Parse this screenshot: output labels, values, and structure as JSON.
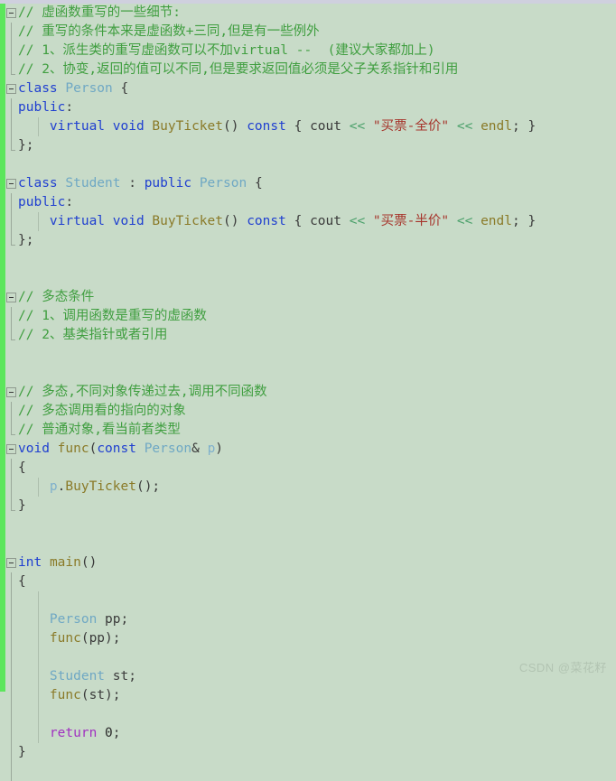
{
  "editor": {
    "background_color": "#c8dbc8",
    "change_bar_color": "#5ce65c",
    "watermark": "CSDN @菜花籽"
  },
  "colors": {
    "comment": "#3f9e3f",
    "keyword": "#1f3fd0",
    "type": "#6fa8c4",
    "function": "#8a7a28",
    "string": "#a6342b",
    "operator": "#4aa06a",
    "return_keyword": "#a030c0",
    "plain": "#3a3a3a"
  },
  "lines": [
    {
      "id": 1,
      "fold": "box",
      "indent": 0,
      "tokens": [
        {
          "t": "// 虚函数重写的一些细节:",
          "c": "cmt"
        }
      ]
    },
    {
      "id": 2,
      "fold": "line",
      "indent": 0,
      "tokens": [
        {
          "t": "// 重写的条件本来是虚函数+三同,但是有一些例外",
          "c": "cmt"
        }
      ]
    },
    {
      "id": 3,
      "fold": "line",
      "indent": 0,
      "tokens": [
        {
          "t": "// 1、派生类的重写虚函数可以不加virtual --  (建议大家都加上)",
          "c": "cmt"
        }
      ]
    },
    {
      "id": 4,
      "fold": "end",
      "indent": 0,
      "tokens": [
        {
          "t": "// 2、协变,返回的值可以不同,但是要求返回值必须是父子关系指针和引用",
          "c": "cmt"
        }
      ]
    },
    {
      "id": 5,
      "fold": "box",
      "indent": 0,
      "tokens": [
        {
          "t": "class",
          "c": "kw"
        },
        {
          "t": " ",
          "c": "plain"
        },
        {
          "t": "Person",
          "c": "type"
        },
        {
          "t": " {",
          "c": "plain"
        }
      ]
    },
    {
      "id": 6,
      "fold": "line",
      "indent": 0,
      "tokens": [
        {
          "t": "public",
          "c": "kw"
        },
        {
          "t": ":",
          "c": "plain"
        }
      ]
    },
    {
      "id": 7,
      "fold": "line",
      "indent": 1,
      "guide": true,
      "tokens": [
        {
          "t": "    ",
          "c": "plain"
        },
        {
          "t": "virtual",
          "c": "kw"
        },
        {
          "t": " ",
          "c": "plain"
        },
        {
          "t": "void",
          "c": "kw"
        },
        {
          "t": " ",
          "c": "plain"
        },
        {
          "t": "BuyTicket",
          "c": "fn"
        },
        {
          "t": "() ",
          "c": "plain"
        },
        {
          "t": "const",
          "c": "kw"
        },
        {
          "t": " { ",
          "c": "plain"
        },
        {
          "t": "cout",
          "c": "plain"
        },
        {
          "t": " ",
          "c": "plain"
        },
        {
          "t": "<<",
          "c": "op"
        },
        {
          "t": " ",
          "c": "plain"
        },
        {
          "t": "\"买票-全价\"",
          "c": "str"
        },
        {
          "t": " ",
          "c": "plain"
        },
        {
          "t": "<<",
          "c": "op"
        },
        {
          "t": " ",
          "c": "plain"
        },
        {
          "t": "endl",
          "c": "fn"
        },
        {
          "t": "; }",
          "c": "plain"
        }
      ]
    },
    {
      "id": 8,
      "fold": "end",
      "indent": 0,
      "tokens": [
        {
          "t": "};",
          "c": "plain"
        }
      ]
    },
    {
      "id": 9,
      "fold": "none",
      "indent": 0,
      "tokens": []
    },
    {
      "id": 10,
      "fold": "box",
      "indent": 0,
      "tokens": [
        {
          "t": "class",
          "c": "kw"
        },
        {
          "t": " ",
          "c": "plain"
        },
        {
          "t": "Student",
          "c": "type"
        },
        {
          "t": " : ",
          "c": "plain"
        },
        {
          "t": "public",
          "c": "kw"
        },
        {
          "t": " ",
          "c": "plain"
        },
        {
          "t": "Person",
          "c": "type"
        },
        {
          "t": " {",
          "c": "plain"
        }
      ]
    },
    {
      "id": 11,
      "fold": "line",
      "indent": 0,
      "tokens": [
        {
          "t": "public",
          "c": "kw"
        },
        {
          "t": ":",
          "c": "plain"
        }
      ]
    },
    {
      "id": 12,
      "fold": "line",
      "indent": 1,
      "guide": true,
      "tokens": [
        {
          "t": "    ",
          "c": "plain"
        },
        {
          "t": "virtual",
          "c": "kw"
        },
        {
          "t": " ",
          "c": "plain"
        },
        {
          "t": "void",
          "c": "kw"
        },
        {
          "t": " ",
          "c": "plain"
        },
        {
          "t": "BuyTicket",
          "c": "fn"
        },
        {
          "t": "() ",
          "c": "plain"
        },
        {
          "t": "const",
          "c": "kw"
        },
        {
          "t": " { ",
          "c": "plain"
        },
        {
          "t": "cout",
          "c": "plain"
        },
        {
          "t": " ",
          "c": "plain"
        },
        {
          "t": "<<",
          "c": "op"
        },
        {
          "t": " ",
          "c": "plain"
        },
        {
          "t": "\"买票-半价\"",
          "c": "str"
        },
        {
          "t": " ",
          "c": "plain"
        },
        {
          "t": "<<",
          "c": "op"
        },
        {
          "t": " ",
          "c": "plain"
        },
        {
          "t": "endl",
          "c": "fn"
        },
        {
          "t": "; }",
          "c": "plain"
        }
      ]
    },
    {
      "id": 13,
      "fold": "end",
      "indent": 0,
      "tokens": [
        {
          "t": "};",
          "c": "plain"
        }
      ]
    },
    {
      "id": 14,
      "fold": "none",
      "indent": 0,
      "tokens": []
    },
    {
      "id": 15,
      "fold": "none",
      "indent": 0,
      "tokens": []
    },
    {
      "id": 16,
      "fold": "box",
      "indent": 0,
      "tokens": [
        {
          "t": "// 多态条件",
          "c": "cmt"
        }
      ]
    },
    {
      "id": 17,
      "fold": "line",
      "indent": 0,
      "tokens": [
        {
          "t": "// 1、调用函数是重写的虚函数",
          "c": "cmt"
        }
      ]
    },
    {
      "id": 18,
      "fold": "end",
      "indent": 0,
      "tokens": [
        {
          "t": "// 2、基类指针或者引用",
          "c": "cmt"
        }
      ]
    },
    {
      "id": 19,
      "fold": "none",
      "indent": 0,
      "tokens": []
    },
    {
      "id": 20,
      "fold": "none",
      "indent": 0,
      "tokens": []
    },
    {
      "id": 21,
      "fold": "box",
      "indent": 0,
      "tokens": [
        {
          "t": "// 多态,不同对象传递过去,调用不同函数",
          "c": "cmt"
        }
      ]
    },
    {
      "id": 22,
      "fold": "line",
      "indent": 0,
      "tokens": [
        {
          "t": "// 多态调用看的指向的对象",
          "c": "cmt"
        }
      ]
    },
    {
      "id": 23,
      "fold": "end",
      "indent": 0,
      "tokens": [
        {
          "t": "// 普通对象,看当前者类型",
          "c": "cmt"
        }
      ]
    },
    {
      "id": 24,
      "fold": "box",
      "indent": 0,
      "tokens": [
        {
          "t": "void",
          "c": "kw"
        },
        {
          "t": " ",
          "c": "plain"
        },
        {
          "t": "func",
          "c": "fn"
        },
        {
          "t": "(",
          "c": "plain"
        },
        {
          "t": "const",
          "c": "kw"
        },
        {
          "t": " ",
          "c": "plain"
        },
        {
          "t": "Person",
          "c": "type"
        },
        {
          "t": "& ",
          "c": "plain"
        },
        {
          "t": "p",
          "c": "var"
        },
        {
          "t": ")",
          "c": "plain"
        }
      ]
    },
    {
      "id": 25,
      "fold": "line",
      "indent": 0,
      "tokens": [
        {
          "t": "{",
          "c": "plain"
        }
      ]
    },
    {
      "id": 26,
      "fold": "line",
      "indent": 1,
      "guide": true,
      "tokens": [
        {
          "t": "    ",
          "c": "plain"
        },
        {
          "t": "p",
          "c": "var"
        },
        {
          "t": ".",
          "c": "plain"
        },
        {
          "t": "BuyTicket",
          "c": "fn"
        },
        {
          "t": "();",
          "c": "plain"
        }
      ]
    },
    {
      "id": 27,
      "fold": "end",
      "indent": 0,
      "tokens": [
        {
          "t": "}",
          "c": "plain"
        }
      ]
    },
    {
      "id": 28,
      "fold": "none",
      "indent": 0,
      "tokens": []
    },
    {
      "id": 29,
      "fold": "none",
      "indent": 0,
      "tokens": []
    },
    {
      "id": 30,
      "fold": "box",
      "indent": 0,
      "tokens": [
        {
          "t": "int",
          "c": "kw"
        },
        {
          "t": " ",
          "c": "plain"
        },
        {
          "t": "main",
          "c": "fn"
        },
        {
          "t": "()",
          "c": "plain"
        }
      ]
    },
    {
      "id": 31,
      "fold": "line",
      "indent": 0,
      "tokens": [
        {
          "t": "{",
          "c": "plain"
        }
      ]
    },
    {
      "id": 32,
      "fold": "line",
      "indent": 1,
      "guide": true,
      "tokens": []
    },
    {
      "id": 33,
      "fold": "line",
      "indent": 1,
      "guide": true,
      "tokens": [
        {
          "t": "    ",
          "c": "plain"
        },
        {
          "t": "Person",
          "c": "type"
        },
        {
          "t": " ",
          "c": "plain"
        },
        {
          "t": "pp",
          "c": "plain"
        },
        {
          "t": ";",
          "c": "plain"
        }
      ]
    },
    {
      "id": 34,
      "fold": "line",
      "indent": 1,
      "guide": true,
      "tokens": [
        {
          "t": "    ",
          "c": "plain"
        },
        {
          "t": "func",
          "c": "fn"
        },
        {
          "t": "(",
          "c": "plain"
        },
        {
          "t": "pp",
          "c": "plain"
        },
        {
          "t": ");",
          "c": "plain"
        }
      ]
    },
    {
      "id": 35,
      "fold": "line",
      "indent": 1,
      "guide": true,
      "tokens": []
    },
    {
      "id": 36,
      "fold": "line",
      "indent": 1,
      "guide": true,
      "tokens": [
        {
          "t": "    ",
          "c": "plain"
        },
        {
          "t": "Student",
          "c": "type"
        },
        {
          "t": " ",
          "c": "plain"
        },
        {
          "t": "st",
          "c": "plain"
        },
        {
          "t": ";",
          "c": "plain"
        }
      ]
    },
    {
      "id": 37,
      "fold": "line",
      "indent": 1,
      "guide": true,
      "tokens": [
        {
          "t": "    ",
          "c": "plain"
        },
        {
          "t": "func",
          "c": "fn"
        },
        {
          "t": "(",
          "c": "plain"
        },
        {
          "t": "st",
          "c": "plain"
        },
        {
          "t": ");",
          "c": "plain"
        }
      ]
    },
    {
      "id": 38,
      "fold": "line",
      "indent": 1,
      "guide": true,
      "tokens": []
    },
    {
      "id": 39,
      "fold": "line",
      "indent": 1,
      "guide": true,
      "tokens": [
        {
          "t": "    ",
          "c": "plain"
        },
        {
          "t": "return",
          "c": "ret"
        },
        {
          "t": " ",
          "c": "plain"
        },
        {
          "t": "0",
          "c": "num"
        },
        {
          "t": ";",
          "c": "plain"
        }
      ]
    },
    {
      "id": 40,
      "fold": "line",
      "indent": 0,
      "tokens": [
        {
          "t": "}",
          "c": "plain"
        }
      ]
    },
    {
      "id": 41,
      "fold": "line",
      "indent": 0,
      "tokens": []
    }
  ]
}
